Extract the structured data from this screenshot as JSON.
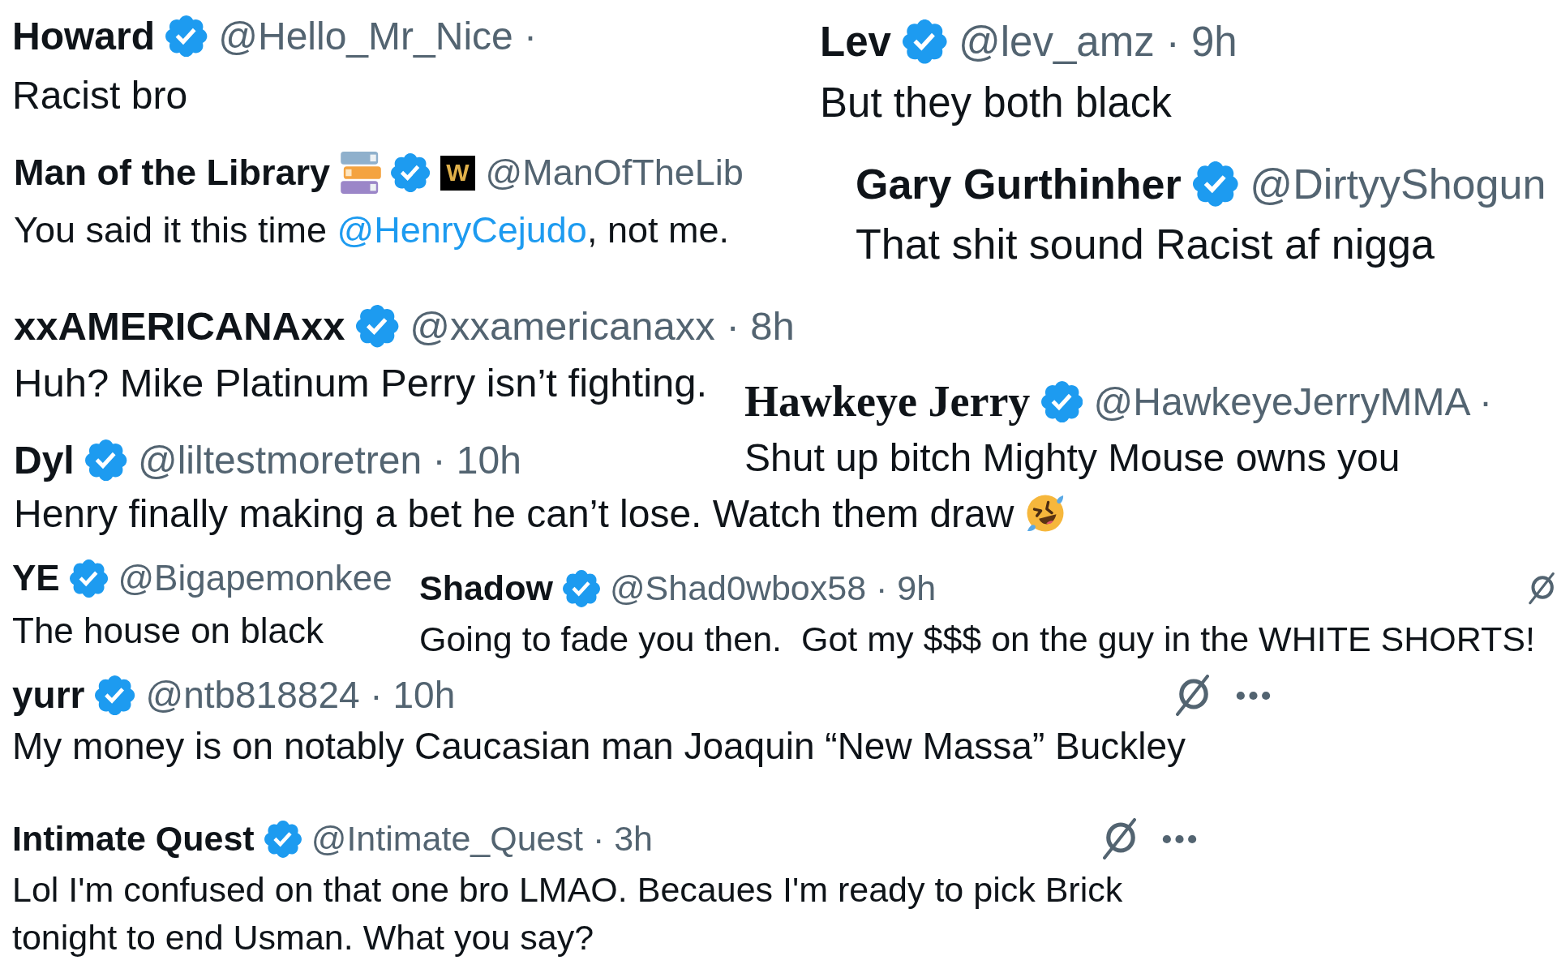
{
  "tweets": [
    {
      "name": "Howard",
      "verified": true,
      "handle": "@Hello_Mr_Nice ·",
      "text": [
        {
          "kind": "plain",
          "text": "Racist bro"
        }
      ]
    },
    {
      "name": "Lev",
      "verified": true,
      "handle": "@lev_amz · 9h",
      "text": [
        {
          "kind": "plain",
          "text": "But they both black"
        }
      ]
    },
    {
      "name": "Man of the Library",
      "verified": true,
      "affiliate_badge": "W",
      "handle": "@ManOfTheLib",
      "text": [
        {
          "kind": "plain",
          "text": "You said it this time "
        },
        {
          "kind": "mention",
          "text": "@HenryCejudo"
        },
        {
          "kind": "plain",
          "text": ", not me."
        }
      ]
    },
    {
      "name": "Gary Gurthinher",
      "verified": true,
      "handle": "@DirtyyShogun",
      "text": [
        {
          "kind": "plain",
          "text": "That shit sound Racist af nigga"
        }
      ]
    },
    {
      "name": "xxAMERICANAxx",
      "verified": true,
      "handle": "@xxamericanaxx · 8h",
      "text": [
        {
          "kind": "plain",
          "text": "Huh? Mike Platinum Perry isn’t fighting."
        }
      ]
    },
    {
      "name": "Hawkeye Jerry",
      "verified": true,
      "handle": "@HawkeyeJerryMMA ·",
      "text": [
        {
          "kind": "plain",
          "text": "Shut up bitch Mighty Mouse owns you"
        }
      ]
    },
    {
      "name": "Dyl",
      "verified": true,
      "handle": "@liltestmoretren · 10h",
      "text": [
        {
          "kind": "plain",
          "text": "Henry finally making a bet he can’t lose. Watch them draw"
        }
      ]
    },
    {
      "name": "YE",
      "verified": true,
      "handle": "@Bigapemonkee",
      "text": [
        {
          "kind": "plain",
          "text": "The house on black"
        }
      ]
    },
    {
      "name": "Shadow",
      "verified": true,
      "handle": "@Shad0wbox58 · 9h",
      "text": [
        {
          "kind": "plain",
          "text": "Going to fade you then.  Got my $$$ on the guy in the WHITE SHORTS!"
        }
      ]
    },
    {
      "name": "yurr",
      "verified": true,
      "handle": "@ntb818824 · 10h",
      "text": [
        {
          "kind": "plain",
          "text": "My money is on notably Caucasian man Joaquin “New Massa” Buckley"
        }
      ]
    },
    {
      "name": "Intimate Quest",
      "verified": true,
      "handle": "@Intimate_Quest · 3h",
      "text": [
        {
          "kind": "plain",
          "text": "Lol I'm confused on that one bro LMAO. Becaues I'm ready to pick Brick tonight to end Usman. What you say?"
        }
      ]
    }
  ]
}
